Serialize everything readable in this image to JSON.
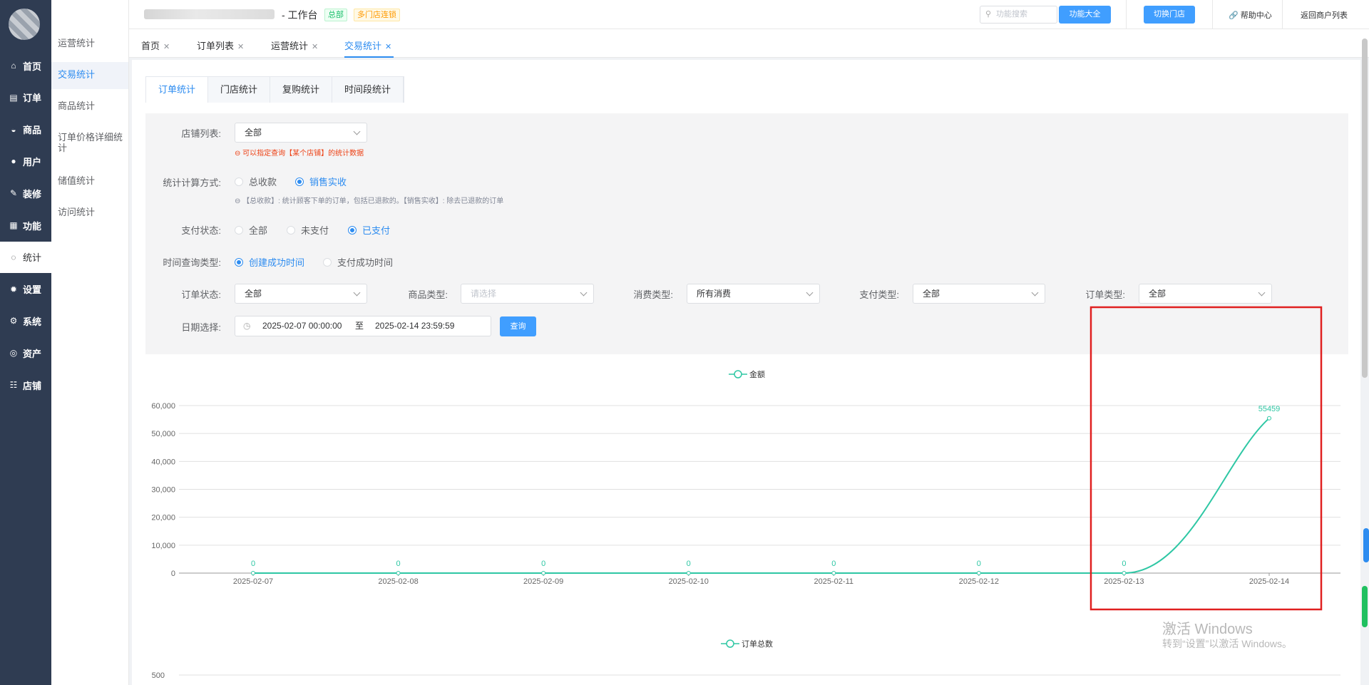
{
  "sidebar": {
    "items": [
      {
        "label": "首页",
        "icon": "home-icon"
      },
      {
        "label": "订单",
        "icon": "clipboard-icon"
      },
      {
        "label": "商品",
        "icon": "bag-icon"
      },
      {
        "label": "用户",
        "icon": "user-icon"
      },
      {
        "label": "装修",
        "icon": "brush-icon"
      },
      {
        "label": "功能",
        "icon": "grid-icon"
      },
      {
        "label": "统计",
        "icon": "chart-icon",
        "active": true
      },
      {
        "label": "设置",
        "icon": "gear-icon"
      },
      {
        "label": "系统",
        "icon": "system-gear-icon"
      },
      {
        "label": "资产",
        "icon": "asset-icon"
      },
      {
        "label": "店铺",
        "icon": "store-icon"
      }
    ]
  },
  "subnav": {
    "items": [
      {
        "label": "运营统计"
      },
      {
        "label": "交易统计",
        "active": true
      },
      {
        "label": "商品统计"
      },
      {
        "label": "订单价格详细统计"
      },
      {
        "label": "储值统计"
      },
      {
        "label": "访问统计"
      }
    ]
  },
  "header": {
    "title": "- 工作台",
    "tag_hq": "总部",
    "tag_chain": "多门店连锁",
    "search_placeholder": "功能搜索",
    "all_functions": "功能大全",
    "switch_store": "切换门店",
    "help": "帮助中心",
    "back_merchants": "返回商户列表"
  },
  "tabs": [
    {
      "label": "首页"
    },
    {
      "label": "订单列表"
    },
    {
      "label": "运营统计"
    },
    {
      "label": "交易统计",
      "active": true
    }
  ],
  "subtabs": [
    {
      "label": "订单统计",
      "active": true
    },
    {
      "label": "门店统计"
    },
    {
      "label": "复购统计"
    },
    {
      "label": "时间段统计"
    }
  ],
  "filters": {
    "store_list": {
      "label": "店铺列表:",
      "value": "全部",
      "hint": "可以指定查询【某个店铺】的统计数据"
    },
    "calc_method": {
      "label": "统计计算方式:",
      "options": [
        "总收款",
        "销售实收"
      ],
      "selected": "销售实收",
      "hint": "【总收款】: 统计顾客下单的订单，包括已退款的。【销售实收】: 除去已退款的订单"
    },
    "pay_status": {
      "label": "支付状态:",
      "options": [
        "全部",
        "未支付",
        "已支付"
      ],
      "selected": "已支付"
    },
    "time_type": {
      "label": "时间查询类型:",
      "options": [
        "创建成功时间",
        "支付成功时间"
      ],
      "selected": "创建成功时间"
    },
    "order_status": {
      "label": "订单状态:",
      "value": "全部"
    },
    "product_type": {
      "label": "商品类型:",
      "placeholder": "请选择"
    },
    "consume_type": {
      "label": "消费类型:",
      "value": "所有消费"
    },
    "pay_type": {
      "label": "支付类型:",
      "value": "全部"
    },
    "order_type": {
      "label": "订单类型:",
      "value": "全部"
    },
    "date": {
      "label": "日期选择:",
      "start": "2025-02-07 00:00:00",
      "sep": "至",
      "end": "2025-02-14 23:59:59"
    },
    "query_button": "查询"
  },
  "colors": {
    "accent": "#2d8cf0",
    "line": "#2ec7a4",
    "highlight": "#e02020",
    "sidebar": "#2f3c52"
  },
  "chart_data": [
    {
      "type": "line",
      "legend": "金额",
      "legend_position": "top-center",
      "x": [
        "2025-02-07",
        "2025-02-08",
        "2025-02-09",
        "2025-02-10",
        "2025-02-11",
        "2025-02-12",
        "2025-02-13",
        "2025-02-14"
      ],
      "series": [
        {
          "name": "金额",
          "values": [
            0,
            0,
            0,
            0,
            0,
            0,
            0,
            55459
          ]
        }
      ],
      "ylim": [
        0,
        60000
      ],
      "yticks": [
        "0",
        "10,000",
        "20,000",
        "30,000",
        "40,000",
        "50,000",
        "60,000"
      ],
      "data_labels": [
        "0",
        "0",
        "0",
        "0",
        "0",
        "0",
        "0",
        "55459"
      ],
      "grid": true,
      "smooth": true
    },
    {
      "type": "line",
      "legend": "订单总数",
      "legend_position": "top-center",
      "yticks_visible": [
        "500"
      ]
    }
  ],
  "watermark": {
    "line1": "激活 Windows",
    "line2": "转到“设置”以激活 Windows。"
  }
}
